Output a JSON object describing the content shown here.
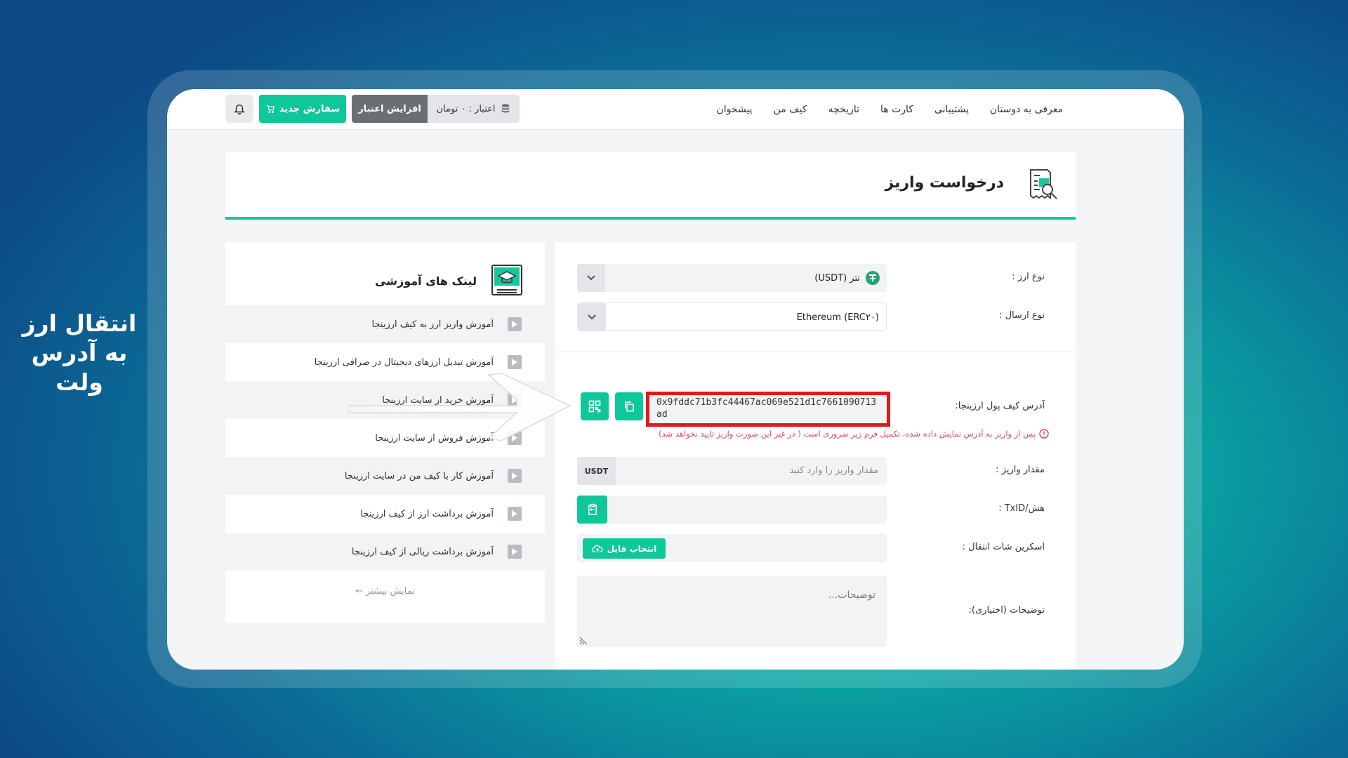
{
  "caption": {
    "line1": "انتقال ارز",
    "line2": "به آدرس ولت"
  },
  "nav": {
    "items": [
      "پیشخوان",
      "کیف من",
      "تاریخچه",
      "کارت ها",
      "پشتیبانی",
      "معرفی به دوستان"
    ],
    "new_order": "سفارش جدید",
    "increase_credit": "افزایش اعتبار",
    "credit": "اعتبار : ۰ تومان"
  },
  "page": {
    "title": "درخواست واریز"
  },
  "links": {
    "title": "لینک های آموزشی",
    "items": [
      "آموزش واریز ارز به کیف ارزینجا",
      "آموزش تبدیل ارزهای دیجیتال در صرافی ارزینجا",
      "آموزش خرید از سایت ارزینجا",
      "آموزش فروش از سایت ارزینجا",
      "آموزش کار با کیف من در سایت ارزینجا",
      "آموزش برداشت ارز از کیف ارزینجا",
      "آموزش برداشت ریالی از کیف ارزینجا"
    ],
    "more": "نمایش بیشتر"
  },
  "form": {
    "currency_label": "نوع ارز :",
    "currency_value": "تتر (USDT)",
    "network_label": "نوع ارسال :",
    "network_value": "Ethereum (ERC۲۰)",
    "address_label": "آدرس کیف پول ارزینجا:",
    "address_value": "0x9fddc71b3fc44467ac069e521d1c7661090713ad",
    "note": "پس از واریز به آدرس نمایش داده شده، تکمیل فرم زیر ضروری است ( در غیر این صورت واریز تایید نخواهد شد)",
    "amount_label": "مقدار واریز :",
    "amount_placeholder": "مقدار واریز را وارد کنید",
    "amount_unit": "USDT",
    "hash_label": "هش/TxID :",
    "screenshot_label": "اسکرین شات انتقال :",
    "file_button": "انتخاب فایل",
    "desc_label": "توضیحات (اختیاری):",
    "desc_placeholder": "توضیحات..."
  },
  "colors": {
    "accent": "#10c79a",
    "highlight": "#e11a1a"
  }
}
